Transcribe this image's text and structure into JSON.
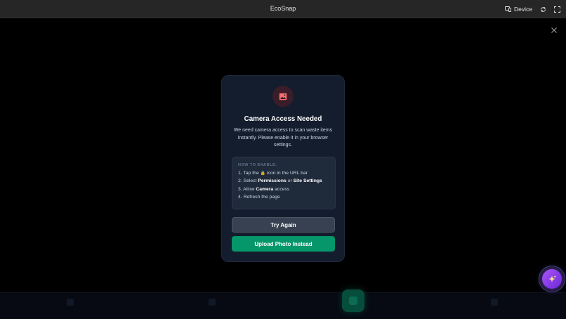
{
  "window": {
    "title": "EcoSnap",
    "device_label": "Device"
  },
  "modal": {
    "title": "Camera Access Needed",
    "description": "We need camera access to scan waste items instantly. Please enable it in your browser settings.",
    "howto_title": "HOW TO ENABLE:",
    "steps": {
      "s1_a": "1. Tap the",
      "s1_b": "icon in the URL bar",
      "s2_a": "2. Select",
      "s2_b": "Permissions",
      "s2_c": "or",
      "s2_d": "Site Settings",
      "s3_a": "3. Allow",
      "s3_b": "Camera",
      "s3_c": "access",
      "s4": "4. Refresh the page"
    },
    "try_again_label": "Try Again",
    "upload_label": "Upload Photo Instead"
  },
  "colors": {
    "accent_green": "#059669",
    "ai_purple": "#8b5cf6",
    "icon_red": "#f87171"
  },
  "icons": {
    "device": "monitor-phone-icon",
    "rotate": "rotate-icon",
    "fullscreen": "fullscreen-icon",
    "close": "close-icon",
    "camera_placeholder": "image-icon",
    "ai": "sparkles-icon"
  }
}
